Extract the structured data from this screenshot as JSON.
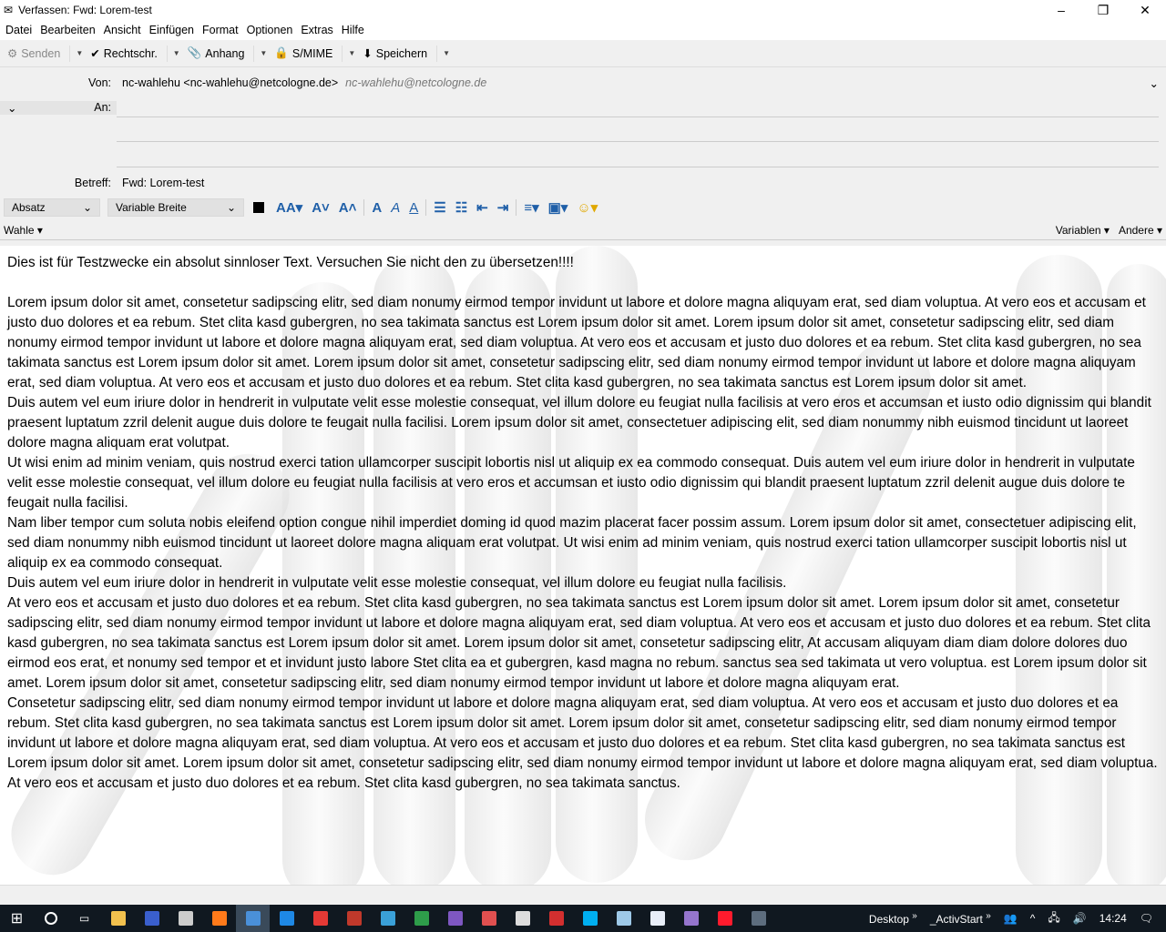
{
  "window": {
    "title": "Verfassen: Fwd: Lorem-test",
    "minimize": "–",
    "maximize": "❐",
    "close": "✕"
  },
  "menu": [
    "Datei",
    "Bearbeiten",
    "Ansicht",
    "Einfügen",
    "Format",
    "Optionen",
    "Extras",
    "Hilfe"
  ],
  "toolbar": {
    "send": "Senden",
    "spell": "Rechtschr.",
    "attach": "Anhang",
    "smime": "S/MIME",
    "save": "Speichern"
  },
  "headers": {
    "from_label": "Von:",
    "from_value": "nc-wahlehu <nc-wahlehu@netcologne.de>",
    "from_hint": "nc-wahlehu@netcologne.de",
    "to_label": "An:",
    "to_value": "",
    "subject_label": "Betreff:",
    "subject_value": "Fwd: Lorem-test"
  },
  "format": {
    "paragraph": "Absatz",
    "font": "Variable Breite"
  },
  "bar2": {
    "wahle": "Wahle",
    "variables": "Variablen",
    "other": "Andere"
  },
  "body": [
    "Dies ist für Testzwecke ein absolut sinnloser Text. Versuchen Sie nicht den zu übersetzen!!!!",
    "",
    "Lorem ipsum dolor sit amet, consetetur sadipscing elitr, sed diam nonumy eirmod tempor invidunt ut labore et dolore magna aliquyam erat, sed diam voluptua. At vero eos et accusam et justo duo dolores et ea rebum. Stet clita kasd gubergren, no sea takimata sanctus est Lorem ipsum dolor sit amet. Lorem ipsum dolor sit amet, consetetur sadipscing elitr, sed diam nonumy eirmod tempor invidunt ut labore et dolore magna aliquyam erat, sed diam voluptua. At vero eos et accusam et justo duo dolores et ea rebum. Stet clita kasd gubergren, no sea takimata sanctus est Lorem ipsum dolor sit amet. Lorem ipsum dolor sit amet, consetetur sadipscing elitr, sed diam nonumy eirmod tempor invidunt ut labore et dolore magna aliquyam erat, sed diam voluptua. At vero eos et accusam et justo duo dolores et ea rebum. Stet clita kasd gubergren, no sea takimata sanctus est Lorem ipsum dolor sit amet.",
    "Duis autem vel eum iriure dolor in hendrerit in vulputate velit esse molestie consequat, vel illum dolore eu feugiat nulla facilisis at vero eros et accumsan et iusto odio dignissim qui blandit praesent luptatum zzril delenit augue duis dolore te feugait nulla facilisi. Lorem ipsum dolor sit amet, consectetuer adipiscing elit, sed diam nonummy nibh euismod tincidunt ut laoreet dolore magna aliquam erat volutpat.",
    "Ut wisi enim ad minim veniam, quis nostrud exerci tation ullamcorper suscipit lobortis nisl ut aliquip ex ea commodo consequat. Duis autem vel eum iriure dolor in hendrerit in vulputate velit esse molestie consequat, vel illum dolore eu feugiat nulla facilisis at vero eros et accumsan et iusto odio dignissim qui blandit praesent luptatum zzril delenit augue duis dolore te feugait nulla facilisi.",
    "Nam liber tempor cum soluta nobis eleifend option congue nihil imperdiet doming id quod mazim placerat facer possim assum. Lorem ipsum dolor sit amet, consectetuer adipiscing elit, sed diam nonummy nibh euismod tincidunt ut laoreet dolore magna aliquam erat volutpat. Ut wisi enim ad minim veniam, quis nostrud exerci tation ullamcorper suscipit lobortis nisl ut aliquip ex ea commodo consequat.",
    "Duis autem vel eum iriure dolor in hendrerit in vulputate velit esse molestie consequat, vel illum dolore eu feugiat nulla facilisis.",
    "At vero eos et accusam et justo duo dolores et ea rebum. Stet clita kasd gubergren, no sea takimata sanctus est Lorem ipsum dolor sit amet. Lorem ipsum dolor sit amet, consetetur sadipscing elitr, sed diam nonumy eirmod tempor invidunt ut labore et dolore magna aliquyam erat, sed diam voluptua. At vero eos et accusam et justo duo dolores et ea rebum. Stet clita kasd gubergren, no sea takimata sanctus est Lorem ipsum dolor sit amet. Lorem ipsum dolor sit amet, consetetur sadipscing elitr, At accusam aliquyam diam diam dolore dolores duo eirmod eos erat, et nonumy sed tempor et et invidunt justo labore Stet clita ea et gubergren, kasd magna no rebum. sanctus sea sed takimata ut vero voluptua. est Lorem ipsum dolor sit amet. Lorem ipsum dolor sit amet, consetetur sadipscing elitr, sed diam nonumy eirmod tempor invidunt ut labore et dolore magna aliquyam erat.",
    "Consetetur sadipscing elitr, sed diam nonumy eirmod tempor invidunt ut labore et dolore magna aliquyam erat, sed diam voluptua. At vero eos et accusam et justo duo dolores et ea rebum. Stet clita kasd gubergren, no sea takimata sanctus est Lorem ipsum dolor sit amet. Lorem ipsum dolor sit amet, consetetur sadipscing elitr, sed diam nonumy eirmod tempor invidunt ut labore et dolore magna aliquyam erat, sed diam voluptua. At vero eos et accusam et justo duo dolores et ea rebum. Stet clita kasd gubergren, no sea takimata sanctus est Lorem ipsum dolor sit amet. Lorem ipsum dolor sit amet, consetetur sadipscing elitr, sed diam nonumy eirmod tempor invidunt ut labore et dolore magna aliquyam erat, sed diam voluptua. At vero eos et accusam et justo duo dolores et ea rebum. Stet clita kasd gubergren, no sea takimata sanctus."
  ],
  "taskbar": {
    "apps": [
      {
        "name": "file-explorer",
        "color": "#f2c14e"
      },
      {
        "name": "save-app",
        "color": "#3a5fcd"
      },
      {
        "name": "store",
        "color": "#cccccc"
      },
      {
        "name": "firefox",
        "color": "#ff7a1a"
      },
      {
        "name": "thunderbird",
        "color": "#4a90d9"
      },
      {
        "name": "edge",
        "color": "#1e88e5"
      },
      {
        "name": "opera-red",
        "color": "#e53935"
      },
      {
        "name": "tool-app",
        "color": "#c0392b"
      },
      {
        "name": "pdf-app",
        "color": "#3aa0d8"
      },
      {
        "name": "green-app",
        "color": "#2e9d4a"
      },
      {
        "name": "visual-studio",
        "color": "#7e57c2"
      },
      {
        "name": "red-app",
        "color": "#e05050"
      },
      {
        "name": "gray-app",
        "color": "#dddddd"
      },
      {
        "name": "b-app",
        "color": "#d32f2f"
      },
      {
        "name": "skype",
        "color": "#00aff0"
      },
      {
        "name": "edit-app",
        "color": "#9ec9e8"
      },
      {
        "name": "document-app",
        "color": "#e8eef8"
      },
      {
        "name": "purple-app",
        "color": "#9575cd"
      },
      {
        "name": "opera",
        "color": "#ff1b2d"
      },
      {
        "name": "lock-app",
        "color": "#5d6d7e"
      }
    ],
    "desktop": "Desktop",
    "activstart": "_ActivStart",
    "chevrons": "»",
    "clock": "14:24"
  }
}
